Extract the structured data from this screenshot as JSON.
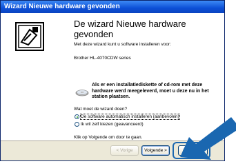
{
  "window": {
    "title": "Wizard Nieuwe hardware gevonden"
  },
  "wizard": {
    "heading": "De wizard Nieuwe hardware gevonden",
    "intro": "Met deze wizard kunt u software installeren voor:",
    "device": "Brother HL-4070CDW series",
    "cd_notice": "Als er een installatiediskette of cd-rom met deze hardware werd meegeleverd, moet u deze nu in het station plaatsen.",
    "question": "Wat moet de wizard doen?",
    "options": [
      {
        "label": "De software automatisch installeren (aanbevolen)",
        "selected": true
      },
      {
        "label": "Ik wil zelf kiezen (geavanceerd)",
        "selected": false
      }
    ],
    "continue_text": "Klik op Volgende om door te gaan."
  },
  "buttons": {
    "back": "< Vorige",
    "next": "Volgende >",
    "cancel": "Annuleren"
  },
  "colors": {
    "arrow": "#1a67b0",
    "title_bar": "#0c4fd6"
  }
}
